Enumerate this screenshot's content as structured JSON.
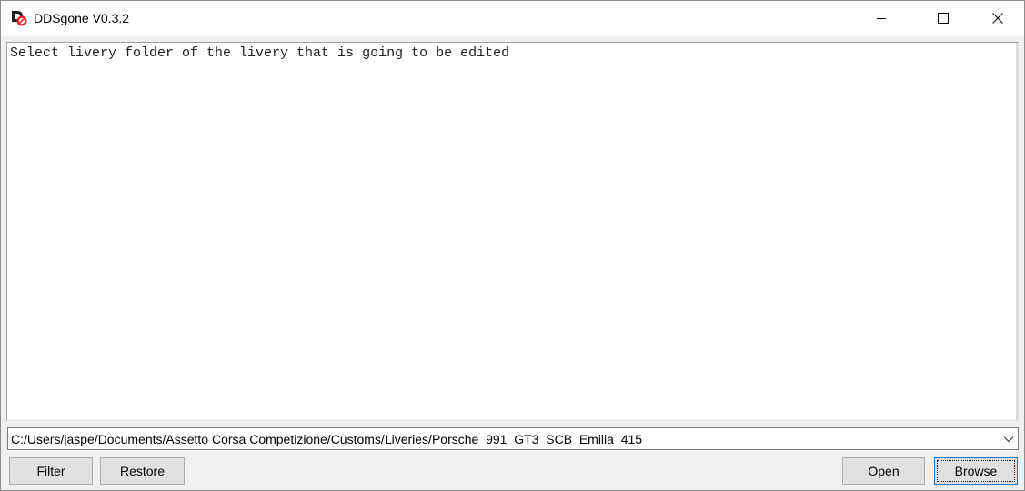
{
  "window": {
    "title": "DDSgone V0.3.2",
    "app_icon": "ddsgone-app-icon",
    "controls": {
      "minimize_icon": "minimize-icon",
      "maximize_icon": "maximize-icon",
      "close_icon": "close-icon"
    }
  },
  "log": {
    "lines": [
      "Select livery folder of the livery that is going to be edited"
    ]
  },
  "path_selector": {
    "value": "C:/Users/jaspe/Documents/Assetto Corsa Competizione/Customs/Liveries/Porsche_991_GT3_SCB_Emilia_415",
    "dropdown_icon": "chevron-down-icon"
  },
  "buttons": {
    "filter": "Filter",
    "restore": "Restore",
    "open": "Open",
    "browse": "Browse"
  },
  "colors": {
    "window_bg": "#f0f0f0",
    "button_bg": "#e1e1e1",
    "focus_border": "#0078d7",
    "icon_red": "#e8232a"
  }
}
